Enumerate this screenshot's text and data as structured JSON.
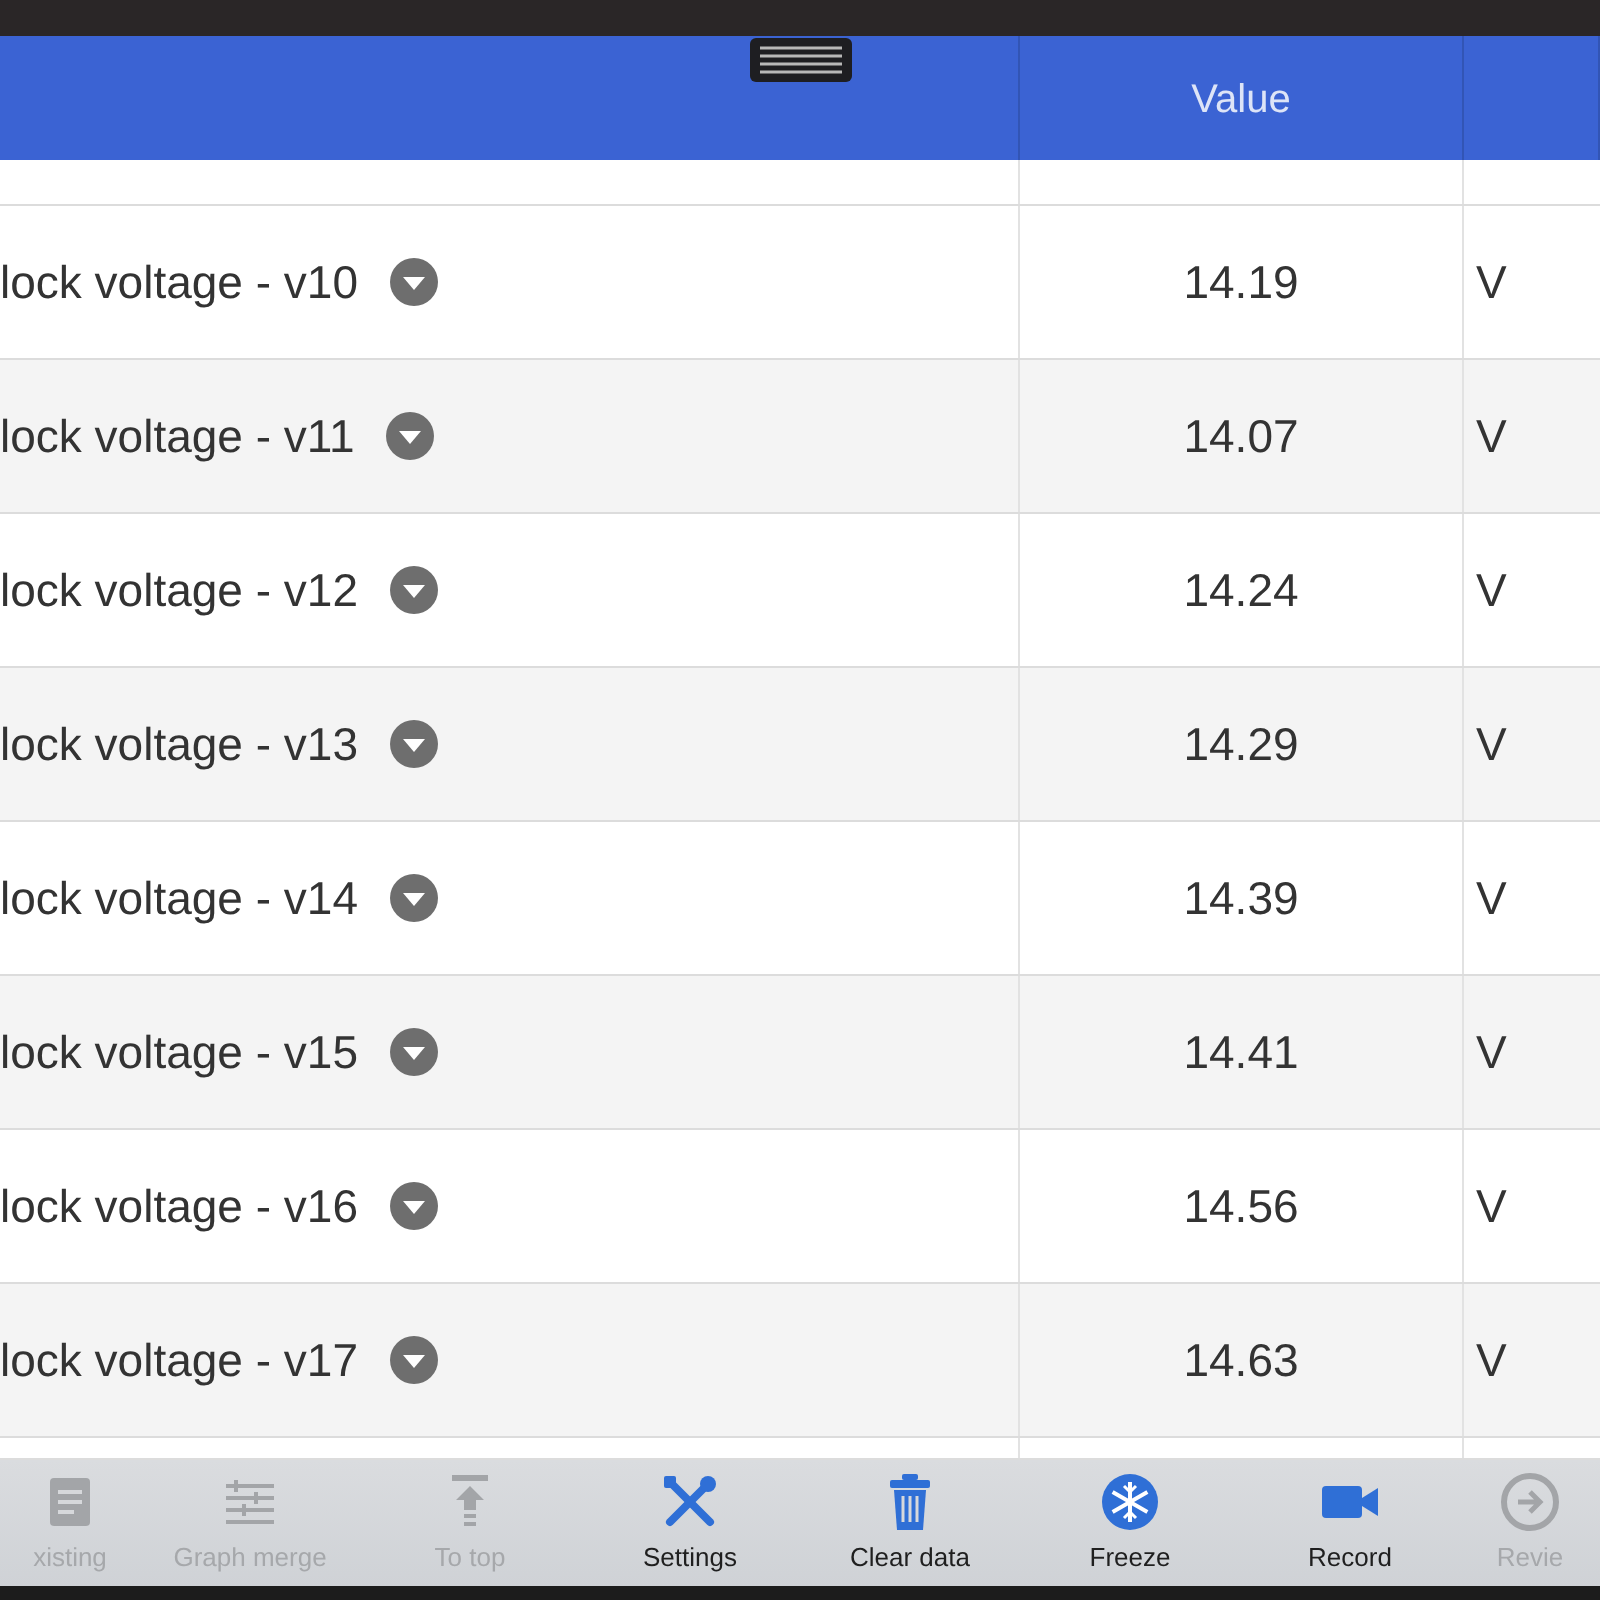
{
  "header": {
    "value_column_title": "Value"
  },
  "rows": [
    {
      "name": "lock voltage - v10",
      "value": "14.19",
      "unit": "V"
    },
    {
      "name": "lock voltage - v11",
      "value": "14.07",
      "unit": "V"
    },
    {
      "name": "lock voltage - v12",
      "value": "14.24",
      "unit": "V"
    },
    {
      "name": "lock voltage - v13",
      "value": "14.29",
      "unit": "V"
    },
    {
      "name": "lock voltage - v14",
      "value": "14.39",
      "unit": "V"
    },
    {
      "name": "lock voltage - v15",
      "value": "14.41",
      "unit": "V"
    },
    {
      "name": "lock voltage - v16",
      "value": "14.56",
      "unit": "V"
    },
    {
      "name": "lock voltage - v17",
      "value": "14.63",
      "unit": "V"
    }
  ],
  "toolbar": [
    {
      "label": "xisting",
      "disabled": true
    },
    {
      "label": "Graph merge",
      "disabled": true
    },
    {
      "label": "To top",
      "disabled": true
    },
    {
      "label": "Settings",
      "disabled": false
    },
    {
      "label": "Clear data",
      "disabled": false
    },
    {
      "label": "Freeze",
      "disabled": false
    },
    {
      "label": "Record",
      "disabled": false
    },
    {
      "label": "Revie",
      "disabled": true
    }
  ]
}
